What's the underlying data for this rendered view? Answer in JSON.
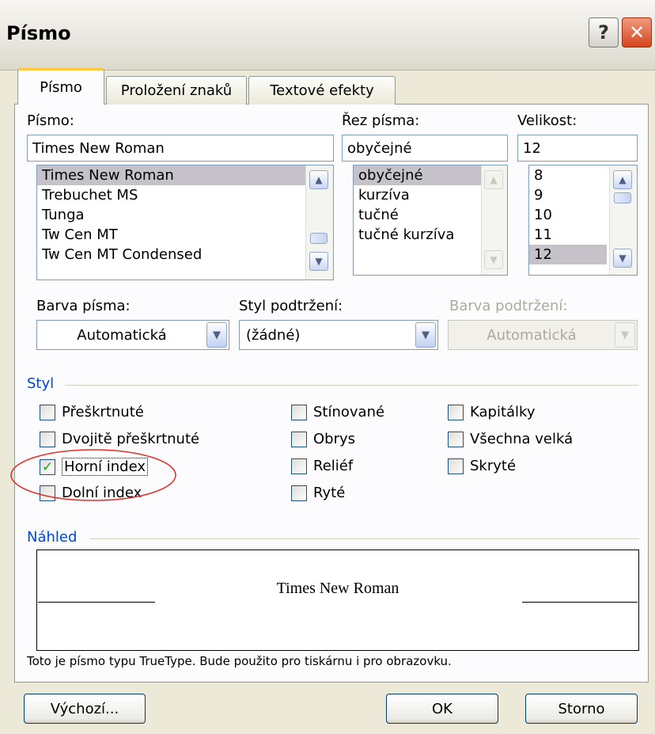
{
  "window": {
    "title": "Písmo",
    "help_glyph": "?",
    "close_glyph": "✕"
  },
  "tabs": [
    {
      "label": "Písmo",
      "active": true
    },
    {
      "label": "Proložení znaků",
      "active": false
    },
    {
      "label": "Textové efekty",
      "active": false
    }
  ],
  "font": {
    "label": "Písmo:",
    "value": "Times New Roman",
    "items": [
      "Times New Roman",
      "Trebuchet MS",
      "Tunga",
      "Tw Cen MT",
      "Tw Cen MT Condensed"
    ],
    "selected": "Times New Roman"
  },
  "style": {
    "label": "Řez písma:",
    "value": "obyčejné",
    "items": [
      "obyčejné",
      "kurzíva",
      "tučné",
      "tučné kurzíva"
    ],
    "selected": "obyčejné"
  },
  "size": {
    "label": "Velikost:",
    "value": "12",
    "items": [
      "8",
      "9",
      "10",
      "11",
      "12"
    ],
    "selected": "12"
  },
  "color": {
    "label": "Barva písma:",
    "value": "Automatická"
  },
  "underline": {
    "label": "Styl podtržení:",
    "value": "(žádné)"
  },
  "underline_color": {
    "label": "Barva podtržení:",
    "value": "Automatická",
    "disabled": true
  },
  "effects": {
    "group_label": "Styl",
    "items": [
      {
        "label": "Přeškrtnuté",
        "checked": false
      },
      {
        "label": "Dvojitě přeškrtnuté",
        "checked": false
      },
      {
        "label": "Horní index",
        "checked": true
      },
      {
        "label": "Dolní index",
        "checked": false
      },
      {
        "label": "Stínované",
        "checked": false
      },
      {
        "label": "Obrys",
        "checked": false
      },
      {
        "label": "Reliéf",
        "checked": false
      },
      {
        "label": "Ryté",
        "checked": false
      },
      {
        "label": "Kapitálky",
        "checked": false
      },
      {
        "label": "Všechna velká",
        "checked": false
      },
      {
        "label": "Skryté",
        "checked": false
      }
    ],
    "check_glyph": "✓"
  },
  "preview": {
    "group_label": "Náhled",
    "sample": "Times New Roman",
    "note": "Toto je písmo typu TrueType. Bude použito pro tiskárnu i pro obrazovku."
  },
  "buttons": {
    "default": "Výchozí...",
    "ok": "OK",
    "cancel": "Storno"
  },
  "colors": {
    "annotation": "#e0302a",
    "accent": "#0046d5"
  }
}
